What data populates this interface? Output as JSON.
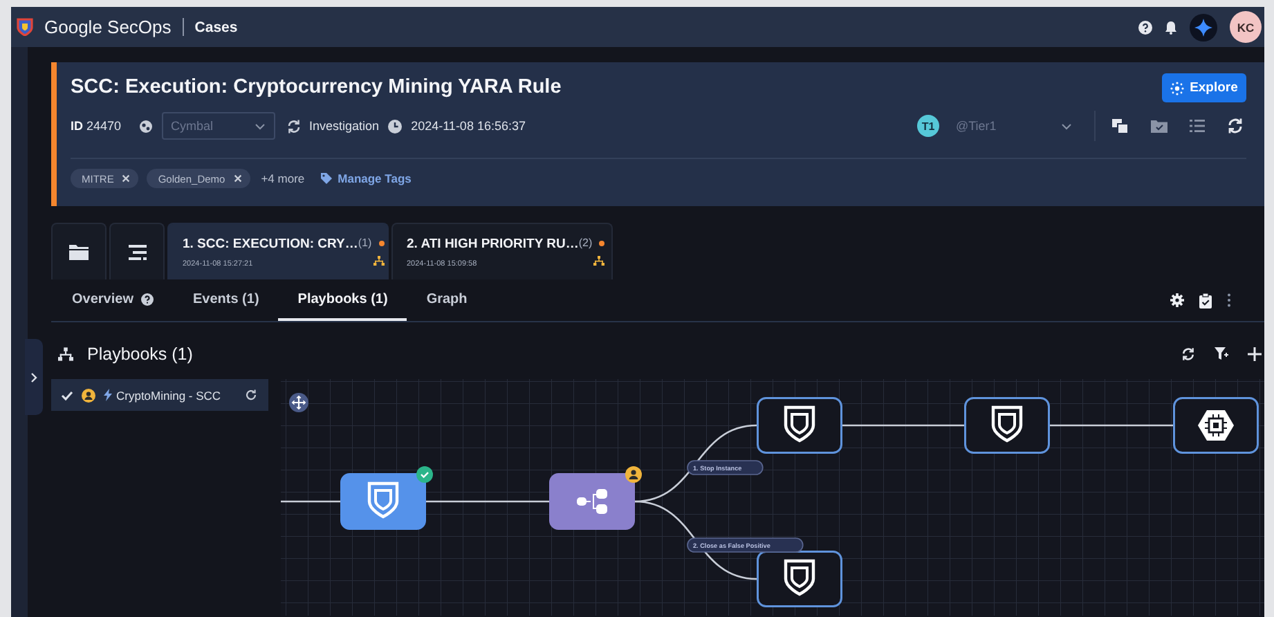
{
  "topbar": {
    "product": "Google SecOps",
    "section": "Cases",
    "user_initials": "KC"
  },
  "case": {
    "title": "SCC: Execution: Cryptocurrency Mining YARA Rule",
    "id_label": "ID",
    "id": "24470",
    "environment": "Cymbal",
    "stage": "Investigation",
    "created": "2024-11-08 16:56:37",
    "assignee_badge": "T1",
    "assignee": "@Tier1",
    "explore_button": "Explore",
    "tags": [
      {
        "label": "MITRE"
      },
      {
        "label": "Golden_Demo"
      }
    ],
    "more_tags": "+4 more",
    "manage_tags": "Manage Tags"
  },
  "alert_tabs": [
    {
      "title": "1. SCC: EXECUTION: CRY…",
      "count": "(1)",
      "time": "2024-11-08 15:27:21",
      "selected": true
    },
    {
      "title": "2. ATI HIGH PRIORITY RU…",
      "count": "(2)",
      "time": "2024-11-08 15:09:58",
      "selected": false
    }
  ],
  "tabs": [
    {
      "label": "Overview",
      "has_help": true,
      "selected": false
    },
    {
      "label": "Events (1)",
      "has_help": false,
      "selected": false
    },
    {
      "label": "Playbooks (1)",
      "has_help": false,
      "selected": true
    },
    {
      "label": "Graph",
      "has_help": false,
      "selected": false
    }
  ],
  "playbooks": {
    "title": "Playbooks (1)",
    "items": [
      {
        "name": "CryptoMining - SCC",
        "checked": true,
        "selected": true
      }
    ]
  },
  "flow": {
    "nodes": [
      {
        "kind": "action",
        "completed": true,
        "awaiting_user": false
      },
      {
        "kind": "condition",
        "completed": false,
        "awaiting_user": true
      },
      {
        "kind": "action",
        "completed": false,
        "awaiting_user": false
      },
      {
        "kind": "action",
        "completed": false,
        "awaiting_user": false
      },
      {
        "kind": "action",
        "completed": false,
        "awaiting_user": false
      },
      {
        "kind": "integration",
        "completed": false,
        "awaiting_user": false
      }
    ],
    "branches": [
      {
        "label": "1. Stop Instance"
      },
      {
        "label": "2. Close as False Positive"
      }
    ]
  }
}
